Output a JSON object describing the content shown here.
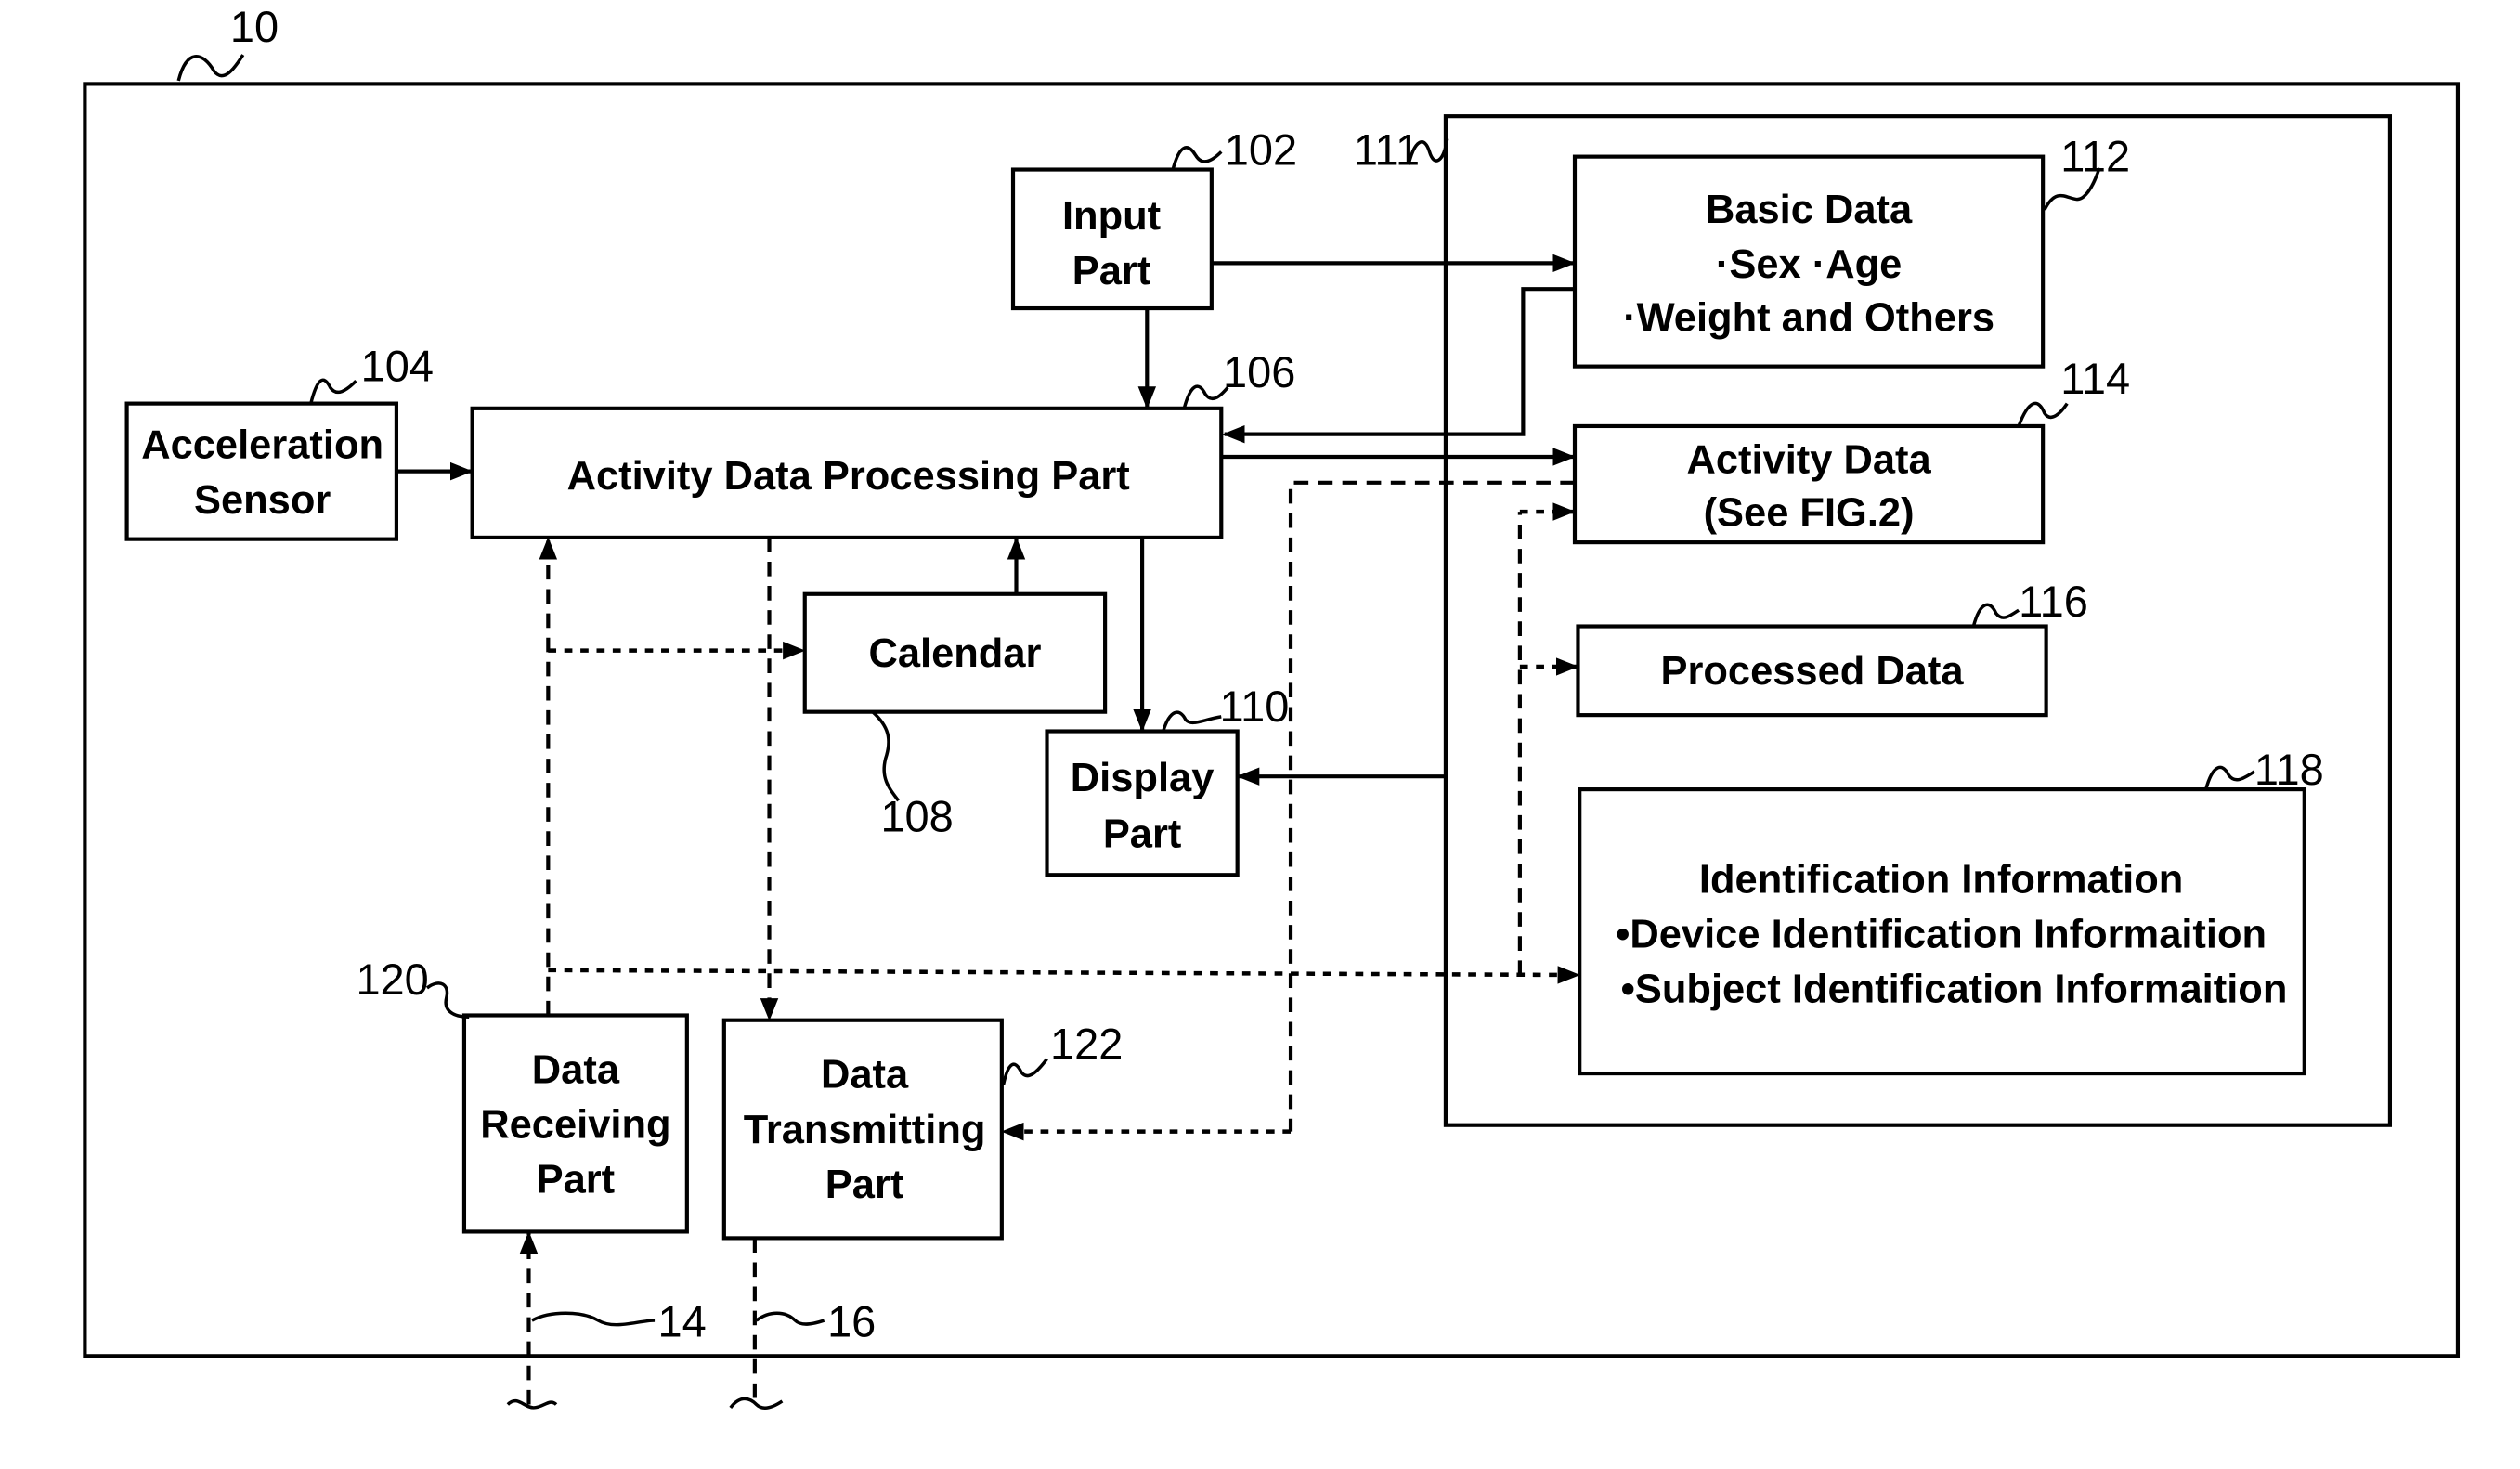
{
  "figure": {
    "device_ref": "10",
    "storage_ref": "111",
    "blocks": {
      "input_part": {
        "ref": "102",
        "lines": [
          "Input",
          "Part"
        ]
      },
      "acceleration_sensor": {
        "ref": "104",
        "lines": [
          "Acceleration",
          "Sensor"
        ]
      },
      "activity_processing": {
        "ref": "106",
        "lines": [
          "Activity Data Processing Part"
        ]
      },
      "calendar": {
        "ref": "108",
        "lines": [
          "Calendar"
        ]
      },
      "display_part": {
        "ref": "110",
        "lines": [
          "Display",
          "Part"
        ]
      },
      "basic_data": {
        "ref": "112",
        "lines": [
          "Basic Data",
          "·Sex ·Age",
          "·Weight and Others"
        ]
      },
      "activity_data": {
        "ref": "114",
        "lines": [
          "Activity Data",
          "(See FIG.2)"
        ]
      },
      "processed_data": {
        "ref": "116",
        "lines": [
          "Processed Data"
        ]
      },
      "identification": {
        "ref": "118",
        "lines": [
          "Identification Information",
          "•Device Identification Informaition",
          "•Subject Identification Informaition"
        ]
      },
      "data_receiving": {
        "ref": "120",
        "lines": [
          "Data",
          "Receiving",
          "Part"
        ]
      },
      "data_transmitting": {
        "ref": "122",
        "lines": [
          "Data",
          "Transmitting",
          "Part"
        ]
      }
    },
    "external_links": {
      "incoming_ref": "14",
      "outgoing_ref": "16"
    }
  }
}
